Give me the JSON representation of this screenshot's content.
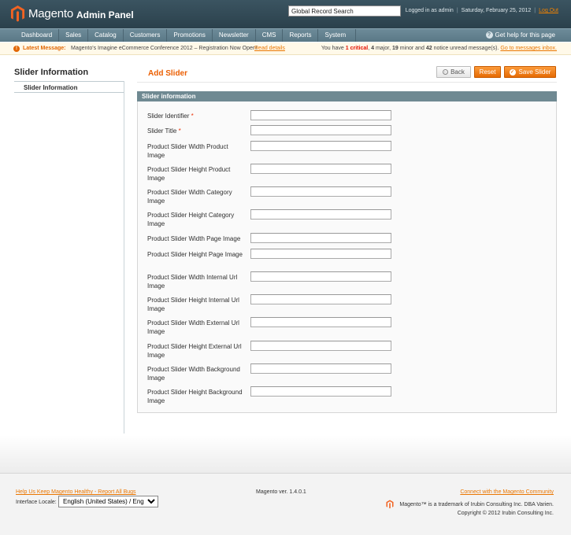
{
  "header": {
    "logo_word": "Magento",
    "logo_sub": "Admin Panel",
    "search_value": "Global Record Search",
    "logged_in": "Logged in as admin",
    "date": "Saturday, February 25, 2012",
    "logout": "Log Out"
  },
  "nav": {
    "items": [
      "Dashboard",
      "Sales",
      "Catalog",
      "Customers",
      "Promotions",
      "Newsletter",
      "CMS",
      "Reports",
      "System"
    ],
    "help": "Get help for this page"
  },
  "message": {
    "latest_label": "Latest Message:",
    "text": "Magento's Imagine eCommerce Conference 2012 – Registration Now Open!",
    "read_details": "Read details",
    "count_prefix": "You have",
    "critical_count": "1 critical",
    "major": "4",
    "minor": "19",
    "notice": "42",
    "count_text_major": "major,",
    "count_text_minor": "minor and",
    "count_text_notice": "notice unread message(s).",
    "inbox_link": "Go to messages inbox."
  },
  "sidebar": {
    "title": "Slider Information",
    "tab": "Slider Information"
  },
  "main": {
    "title": "Add Slider",
    "back": "Back",
    "reset": "Reset",
    "save": "Save Slider",
    "fieldset_title": "Slider information"
  },
  "fields": [
    {
      "label": "Slider Identifier",
      "required": "*",
      "value": ""
    },
    {
      "label": "Slider Title",
      "required": "*",
      "value": ""
    },
    {
      "label": "Product Slider Width Product Image",
      "required": "",
      "value": ""
    },
    {
      "label": "Product Slider Height Product Image",
      "required": "",
      "value": ""
    },
    {
      "label": "Product Slider Width Category Image",
      "required": "",
      "value": ""
    },
    {
      "label": "Product Slider Height Category Image",
      "required": "",
      "value": ""
    },
    {
      "label": "Product Slider Width Page Image",
      "required": "",
      "value": ""
    },
    {
      "label": "Product Slider Height Page Image",
      "required": "",
      "value": ""
    },
    {
      "label": "Product Slider Width Internal Url Image",
      "required": "",
      "value": ""
    },
    {
      "label": "Product Slider Height Internal Url Image",
      "required": "",
      "value": ""
    },
    {
      "label": "Product Slider Width External Url Image",
      "required": "",
      "value": ""
    },
    {
      "label": "Product Slider Height External Url Image",
      "required": "",
      "value": ""
    },
    {
      "label": "Product Slider Width Background Image",
      "required": "",
      "value": ""
    },
    {
      "label": "Product Slider Height Background Image",
      "required": "",
      "value": ""
    }
  ],
  "footer": {
    "help_link": "Help Us Keep Magento Healthy - Report All Bugs",
    "locale_label": "Interface Locale:",
    "locale_value": "English (United States) / English",
    "version": "Magento ver. 1.4.0.1",
    "community": "Connect with the Magento Community",
    "trademark": "Magento™ is a trademark of Irubin Consulting Inc. DBA Varien.",
    "copyright": "Copyright © 2012 Irubin Consulting Inc."
  },
  "colors": {
    "accent": "#eb5e00",
    "header": "#2b414c",
    "nav": "#5a7886",
    "fieldset_head": "#6f8992"
  }
}
